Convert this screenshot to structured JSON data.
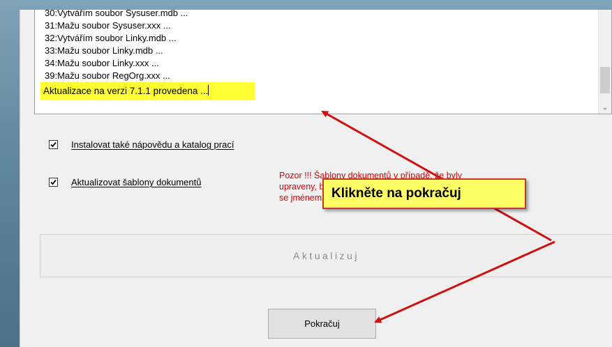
{
  "log": {
    "lines": [
      "30:Vytvářím soubor Sysuser.mdb ...",
      "31:Mažu soubor Sysuser.xxx ...",
      "32:Vytvářím soubor Linky.mdb ...",
      "33:Mažu soubor Linky.mdb ...",
      "34:Mažu soubor Linky.xxx ...",
      "39:Mažu soubor RegOrg.xxx ..."
    ],
    "last_line": "Aktualizace na verzi 7.1.1 provedena ..."
  },
  "options": {
    "help_label": "Instalovat také nápovědu a katalog prací",
    "help_checked": true,
    "templates_label": "Aktualizovat šablony dokumentů",
    "templates_checked": true
  },
  "warning": {
    "line1": "Pozor !!! Šablony dokumentů v případě, že byly",
    "line2": "upraveny, budou přepsány",
    "line3": "se jménem, pod kterým jste je uložili."
  },
  "buttons": {
    "update_label": "Aktualizuj",
    "continue_label": "Pokračuj"
  },
  "callout": {
    "text": "Klikněte na pokračuj"
  },
  "colors": {
    "highlight": "#ffff33",
    "callout_bg": "#ffff66",
    "arrow": "#d01010",
    "warning_text": "#e00000"
  }
}
